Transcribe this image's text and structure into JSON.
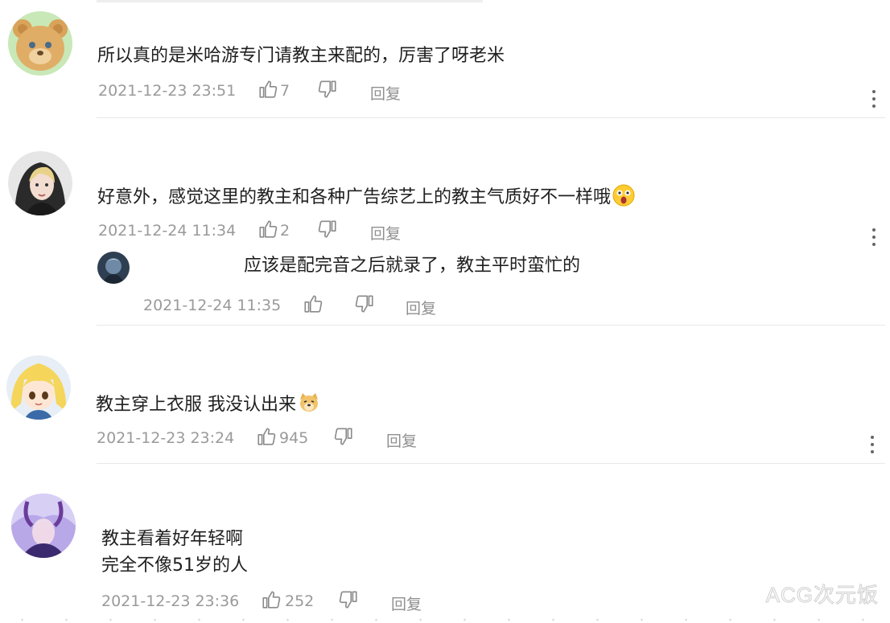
{
  "comments": [
    {
      "text": "所以真的是米哈游专门请教主来配的，厉害了呀老米",
      "time": "2021-12-23 23:51",
      "likes": "7",
      "reply_label": "回复",
      "avatar": "teddy-bear-avatar"
    },
    {
      "text": "好意外，感觉这里的教主和各种广告综艺上的教主气质好不一样哦",
      "time": "2021-12-24 11:34",
      "likes": "2",
      "reply_label": "回复",
      "avatar": "woman-portrait-avatar",
      "trailing_emoji": "surprised-emoji",
      "reply": {
        "text": "应该是配完音之后就录了，教主平时蛮忙的",
        "time": "2021-12-24 11:35",
        "reply_label": "回复",
        "avatar": "dark-character-avatar"
      }
    },
    {
      "text": "教主穿上衣服 我没认出来",
      "time": "2021-12-23 23:24",
      "likes": "945",
      "reply_label": "回复",
      "avatar": "anime-blonde-girl-avatar",
      "trailing_emoji": "doge-emoji"
    },
    {
      "text_line1": "教主看着好年轻啊",
      "text_line2": "完全不像51岁的人",
      "time": "2021-12-23 23:36",
      "likes": "252",
      "reply_label": "回复",
      "avatar": "purple-character-avatar"
    }
  ],
  "watermark": "ACG次元饭",
  "colors": {
    "text": "#1f1f1f",
    "meta": "#9a9a9a",
    "divider": "#e8e8e8"
  }
}
